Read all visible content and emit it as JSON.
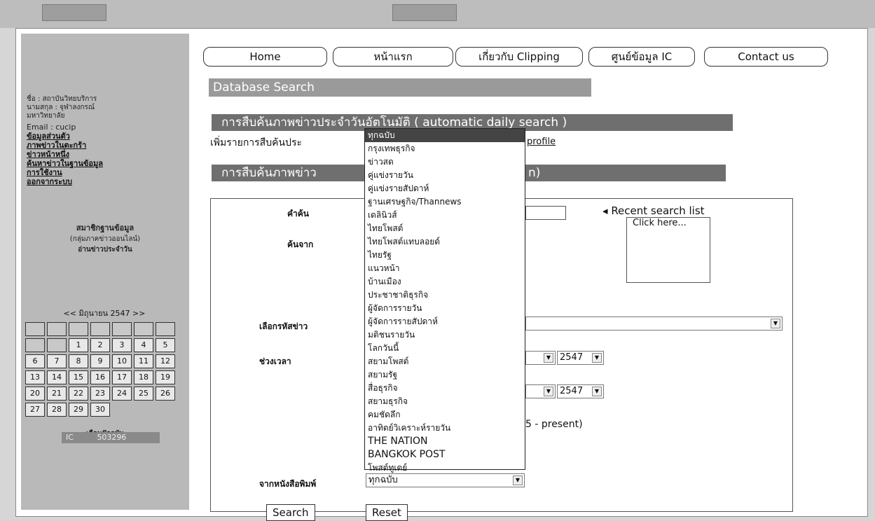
{
  "nav": {
    "home": "Home",
    "front": "หน้าแรก",
    "about": "เกี่ยวกับ Clipping",
    "ic": "ศูนย์ข้อมูล IC",
    "contact": "Contact us"
  },
  "sidebar": {
    "name": "ชื่อ : สถาบันวิทยบริการ",
    "surname": "นามสกุล : จุฬาลงกรณ์",
    "uni": "มหาวิทยาลัย",
    "email": "Email : cucip",
    "links": [
      "ข้อมูลส่วนตัว",
      "ภาพข่าวในตะกร้า",
      "ข่าวหน้าหนึ่ง",
      "ค้นหาข่าวในฐานข้อมูล",
      "การใช้งาน",
      "ออกจากระบบ"
    ],
    "member1": "สมาชิกฐานข้อมูล",
    "member2": "(กลุ่มภาคข่าวออนไลน์)",
    "member3": "อ่านข่าวประจำวัน",
    "cal_header": "<<  มิถุนายน 2547  >>",
    "cal_days": [
      "1",
      "2",
      "3",
      "4",
      "5",
      "6",
      "7",
      "8",
      "9",
      "10",
      "11",
      "12",
      "13",
      "14",
      "15",
      "16",
      "17",
      "18",
      "19",
      "20",
      "21",
      "22",
      "23",
      "24",
      "25",
      "26",
      "27",
      "28",
      "29",
      "30"
    ],
    "today_link": "เดือนปัจจุบัน",
    "counter": "503296"
  },
  "main": {
    "db_title": "Database Search",
    "daily_bar": "การสืบค้นภาพข่าวประจำวันอัตโนมัติ ( automatic daily search )",
    "add_line": "เพิ่มรายการสืบค้นประ",
    "profile_link": "profile",
    "bar2": "การสืบค้นภาพข่าว",
    "bar2_tail": "n)",
    "kw_label": "คำค้น",
    "search_from": "ค้นจาก",
    "recent_title": "Recent search list",
    "recent_box": "Click here...",
    "code_label": "เลือกรหัสข่าว",
    "period_label": "ช่วงเวลา",
    "year1": "2547",
    "year2": "2547",
    "present": "5 - present)",
    "paper_label": "จากหนังสือพิมพ์",
    "paper_value": "ทุกฉบับ",
    "search_btn": "Search",
    "reset_btn": "Reset"
  },
  "dropdown": [
    "ทุกฉบับ",
    "กรุงเทพธุรกิจ",
    "ข่าวสด",
    "คู่แข่งรายวัน",
    "คู่แข่งรายสัปดาห์",
    "ฐานเศรษฐกิจ/Thannews",
    "เดลินิวส์",
    "ไทยโพสต์",
    "ไทยโพสต์แทบลอยด์",
    "ไทยรัฐ",
    "แนวหน้า",
    "บ้านเมือง",
    "ประชาชาติธุรกิจ",
    "ผู้จัดการรายวัน",
    "ผู้จัดการรายสัปดาห์",
    "มติชนรายวัน",
    "โลกวันนี้",
    "สยามโพสต์",
    "สยามรัฐ",
    "สื่อธุรกิจ",
    "สยามธุรกิจ",
    "คมชัดลึก",
    "อาทิตย์วิเคราะห์รายวัน",
    "THE NATION",
    "BANGKOK POST",
    "โพสต์ทูเดย์"
  ]
}
